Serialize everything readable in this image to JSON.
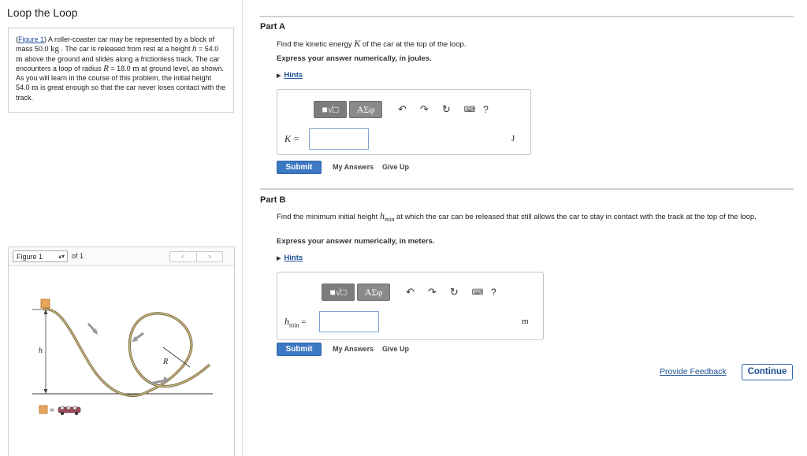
{
  "header": {
    "title": "Loop the Loop"
  },
  "problem": {
    "figure_link": "Figure 1",
    "text_1": ") A roller-coaster car may be represented by a block of mass 50.0 ",
    "kg": "kg",
    "text_2": " . The car is released from rest at a height ",
    "h": "h",
    "text_3": " = 54.0 ",
    "m1": "m",
    "text_4": " above the ground and slides along a frictionless track. The car encounters a loop of radius ",
    "R": "R",
    "text_5": " = 18.0 ",
    "m2": "m",
    "text_6": " at ground level, as shown. As you will learn in the course of this problem, the initial height 54.0 ",
    "m3": "m",
    "text_7": " is great enough so that the car never loses contact with the track."
  },
  "figure_nav": {
    "select_value": "Figure 1",
    "of_text": "of 1",
    "prev": "<",
    "next": ">",
    "label_h": "h",
    "label_R": "R",
    "legend_eq": "="
  },
  "partA": {
    "title": "Part A",
    "question_pre": "Find the kinetic energy ",
    "question_var": "K",
    "question_post": " of the car at the top of the loop.",
    "express": "Express your answer numerically, in joules.",
    "hints": "Hints",
    "var_label": "K =",
    "unit": "J",
    "input_value": "",
    "submit": "Submit",
    "my_answers": "My Answers",
    "give_up": "Give Up"
  },
  "partB": {
    "title": "Part B",
    "question_pre": "Find the minimum initial height ",
    "question_var": "h",
    "question_sub": "min",
    "question_post": " at which the car can be released that still allows the car to stay in contact with the track at the top of the loop.",
    "express": "Express your answer numerically, in meters.",
    "hints": "Hints",
    "var_label": "h",
    "var_sub": "min",
    "var_eq": "=",
    "unit": "m",
    "input_value": "",
    "submit": "Submit",
    "my_answers": "My Answers",
    "give_up": "Give Up"
  },
  "toolbar": {
    "templates_label": "■√□",
    "symbols_label": "AΣφ",
    "undo": "↶",
    "redo": "↷",
    "reset": "↻",
    "keyboard": "⌨",
    "help": "?"
  },
  "footer": {
    "feedback": "Provide Feedback",
    "continue": "Continue"
  }
}
